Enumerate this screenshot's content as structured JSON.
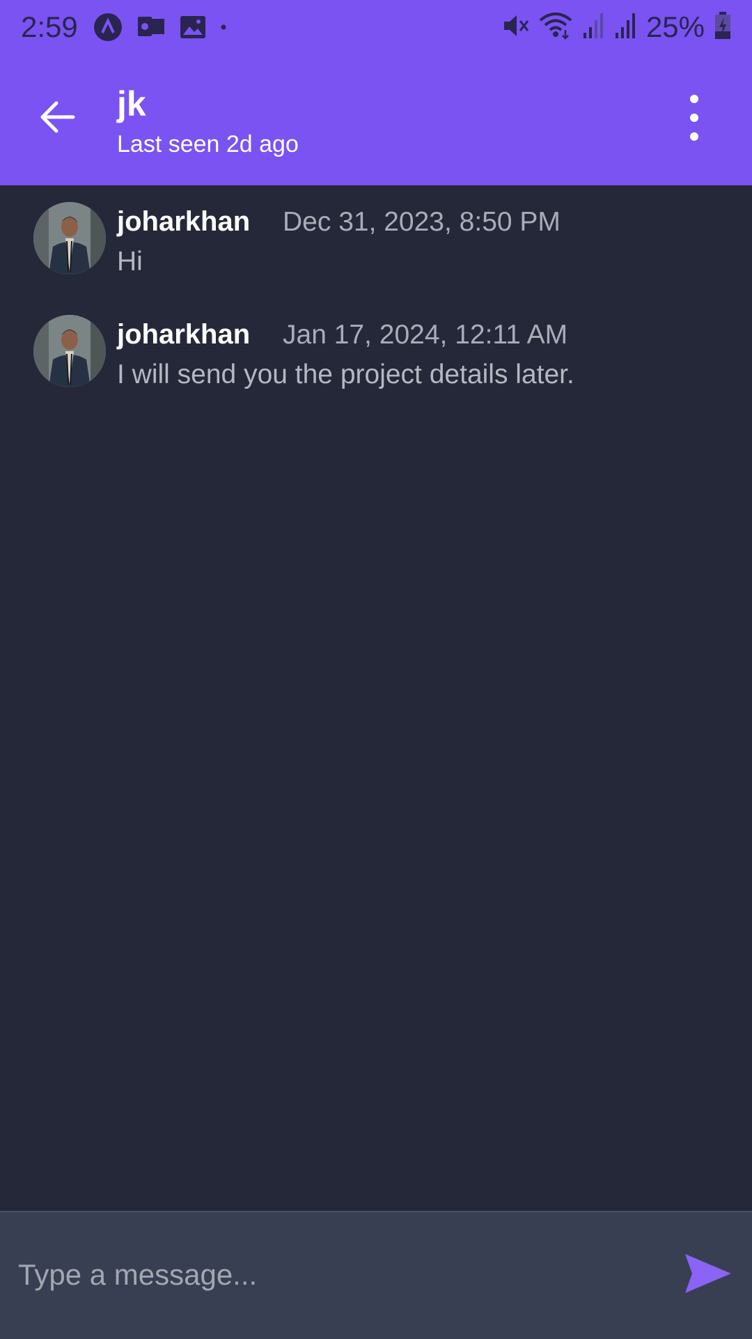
{
  "status_bar": {
    "time": "2:59",
    "battery": "25%",
    "icons": [
      "app-a-icon",
      "outlook-icon",
      "image-icon",
      "dot-icon",
      "mute-icon",
      "wifi-icon",
      "signal-icon",
      "signal-icon",
      "battery-charging-icon"
    ]
  },
  "header": {
    "title": "jk",
    "subtitle": "Last seen 2d ago",
    "back_icon": "arrow-left-icon",
    "menu_icon": "more-vert-icon"
  },
  "messages": [
    {
      "sender": "joharkhan",
      "timestamp": "Dec 31, 2023, 8:50 PM",
      "text": "Hi"
    },
    {
      "sender": "joharkhan",
      "timestamp": "Jan 17, 2024, 12:11 AM",
      "text": "I will send you the project details later."
    }
  ],
  "composer": {
    "placeholder": "Type a message...",
    "value": "",
    "send_icon": "send-icon"
  },
  "colors": {
    "accent": "#7a53f2",
    "background": "#242839",
    "composer_bg": "#383f52",
    "send": "#8b63f5"
  }
}
